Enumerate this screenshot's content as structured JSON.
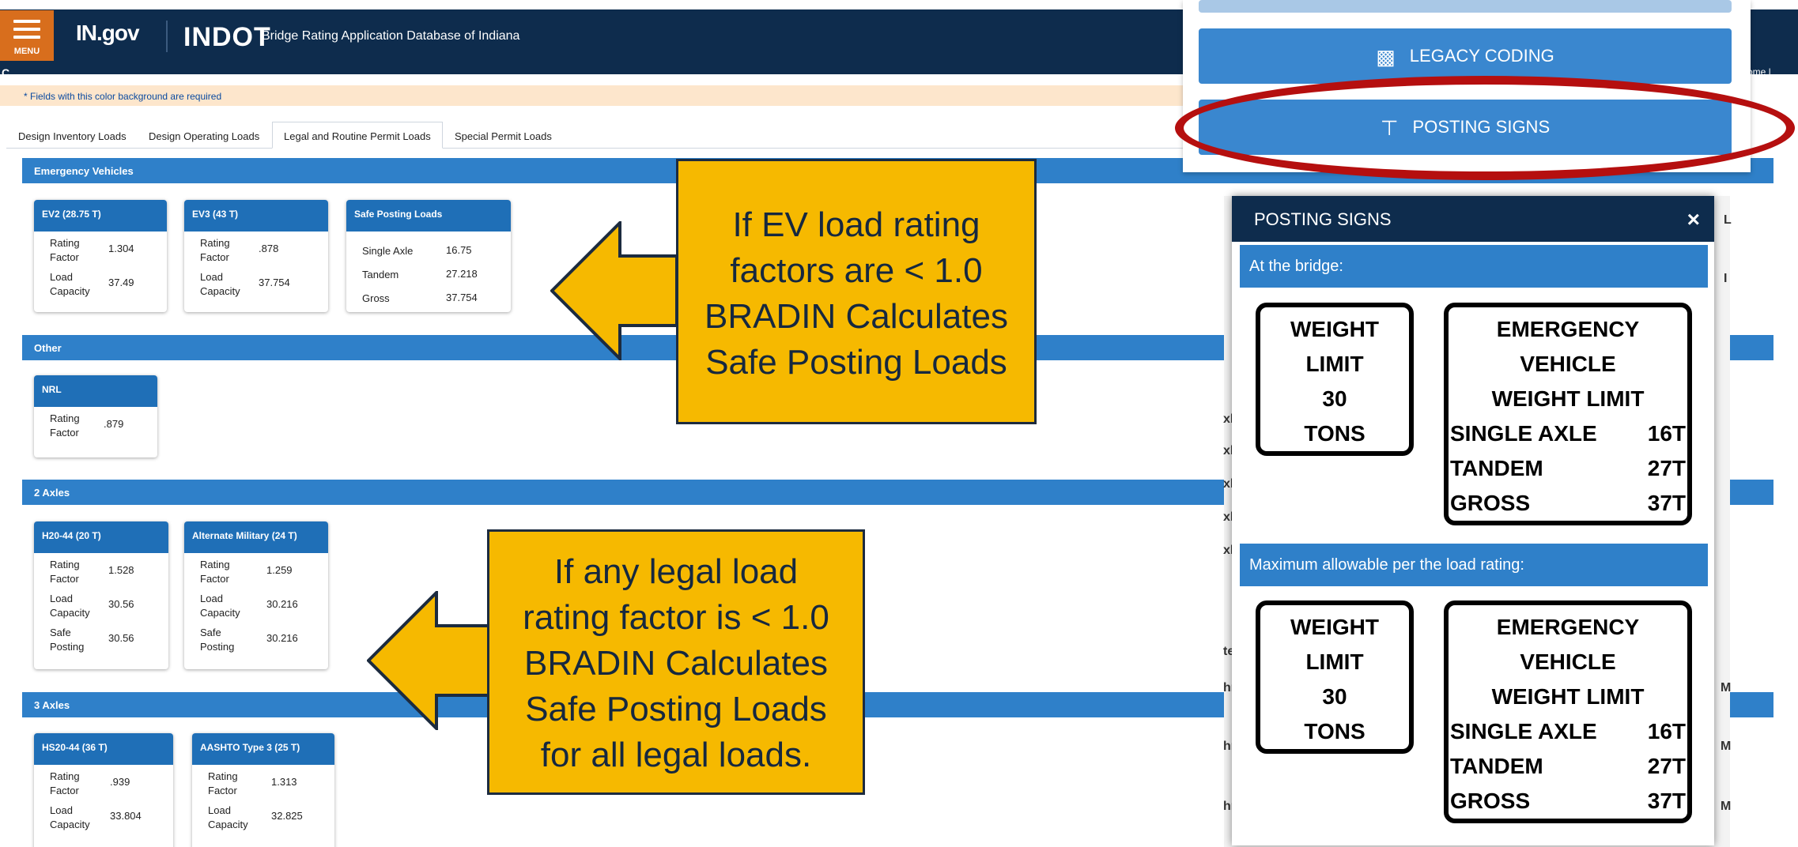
{
  "header": {
    "menu_label": "MENU",
    "logo_text": "IN.gov",
    "agency": "INDOT",
    "app_title": "Bridge Rating Application Database of Indiana",
    "subbar_text": "C",
    "right_fragment_1": "r",
    "right_fragment_2": "ome |"
  },
  "required_note": "* Fields with this color background are required",
  "tabs": [
    {
      "label": "Design Inventory Loads"
    },
    {
      "label": "Design Operating Loads"
    },
    {
      "label": "Legal and Routine Permit Loads"
    },
    {
      "label": "Special Permit Loads"
    }
  ],
  "sections": {
    "emergency": "Emergency Vehicles",
    "other": "Other",
    "two_axles": "2 Axles",
    "three_axles": "3 Axles"
  },
  "cards": {
    "ev2": {
      "title": "EV2 (28.75 T)",
      "rf_label": "Rating Factor",
      "rf": "1.304",
      "lc_label": "Load Capacity",
      "lc": "37.49"
    },
    "ev3": {
      "title": "EV3 (43 T)",
      "rf_label": "Rating Factor",
      "rf": ".878",
      "lc_label": "Load Capacity",
      "lc": "37.754"
    },
    "safe": {
      "title": "Safe Posting Loads",
      "single_label": "Single Axle",
      "single": "16.75",
      "tandem_label": "Tandem",
      "tandem": "27.218",
      "gross_label": "Gross",
      "gross": "37.754"
    },
    "nrl": {
      "title": "NRL",
      "rf_label": "Rating Factor",
      "rf": ".879"
    },
    "h20": {
      "title": "H20-44 (20 T)",
      "rf_label": "Rating Factor",
      "rf": "1.528",
      "lc_label": "Load Capacity",
      "lc": "30.56",
      "sp_label": "Safe Posting",
      "sp": "30.56"
    },
    "alt": {
      "title": "Alternate Military (24 T)",
      "rf_label": "Rating Factor",
      "rf": "1.259",
      "lc_label": "Load Capacity",
      "lc": "30.216",
      "sp_label": "Safe Posting",
      "sp": "30.216"
    },
    "hs20": {
      "title": "HS20-44 (36 T)",
      "rf_label": "Rating Factor",
      "rf": ".939",
      "lc_label": "Load Capacity",
      "lc": "33.804"
    },
    "aashto": {
      "title": "AASHTO Type 3 (25 T)",
      "rf_label": "Rating Factor",
      "rf": "1.313",
      "lc_label": "Load Capacity",
      "lc": "32.825"
    }
  },
  "callouts": {
    "ev": [
      "If  EV load rating",
      "factors are < 1.0",
      "BRADIN Calculates",
      "Safe Posting Loads"
    ],
    "legal": [
      "If any legal load",
      "rating factor is  < 1.0",
      "BRADIN Calculates",
      "Safe Posting Loads",
      "for all legal loads."
    ]
  },
  "dropdown": {
    "legacy_label": "LEGACY CODING",
    "posting_label": "POSTING SIGNS"
  },
  "modal": {
    "title": "POSTING SIGNS",
    "close": "×",
    "at_bridge": "At the bridge:",
    "max_allowable": "Maximum allowable per the load rating:",
    "weight_sign": [
      "WEIGHT",
      "LIMIT",
      "30",
      "TONS"
    ],
    "ev_sign": {
      "lines": [
        "EMERGENCY",
        "VEHICLE",
        "WEIGHT LIMIT"
      ],
      "rows": [
        {
          "label": "SINGLE AXLE",
          "value": "16T"
        },
        {
          "label": "TANDEM",
          "value": "27T"
        },
        {
          "label": "GROSS",
          "value": "37T"
        }
      ]
    }
  },
  "edge_fragments": [
    "xle",
    "xle",
    "xle",
    "xle",
    "xle",
    "te",
    "hn",
    "hn",
    "hn",
    "M",
    "M",
    "M",
    "L",
    "I"
  ],
  "colors": {
    "header_bg": "#0e2c4d",
    "menu_bg": "#d86e1d",
    "section_blue": "#2f80c9",
    "card_header": "#1f6fb7",
    "callout": "#f6b900",
    "highlight_ellipse": "#b50f0f"
  }
}
